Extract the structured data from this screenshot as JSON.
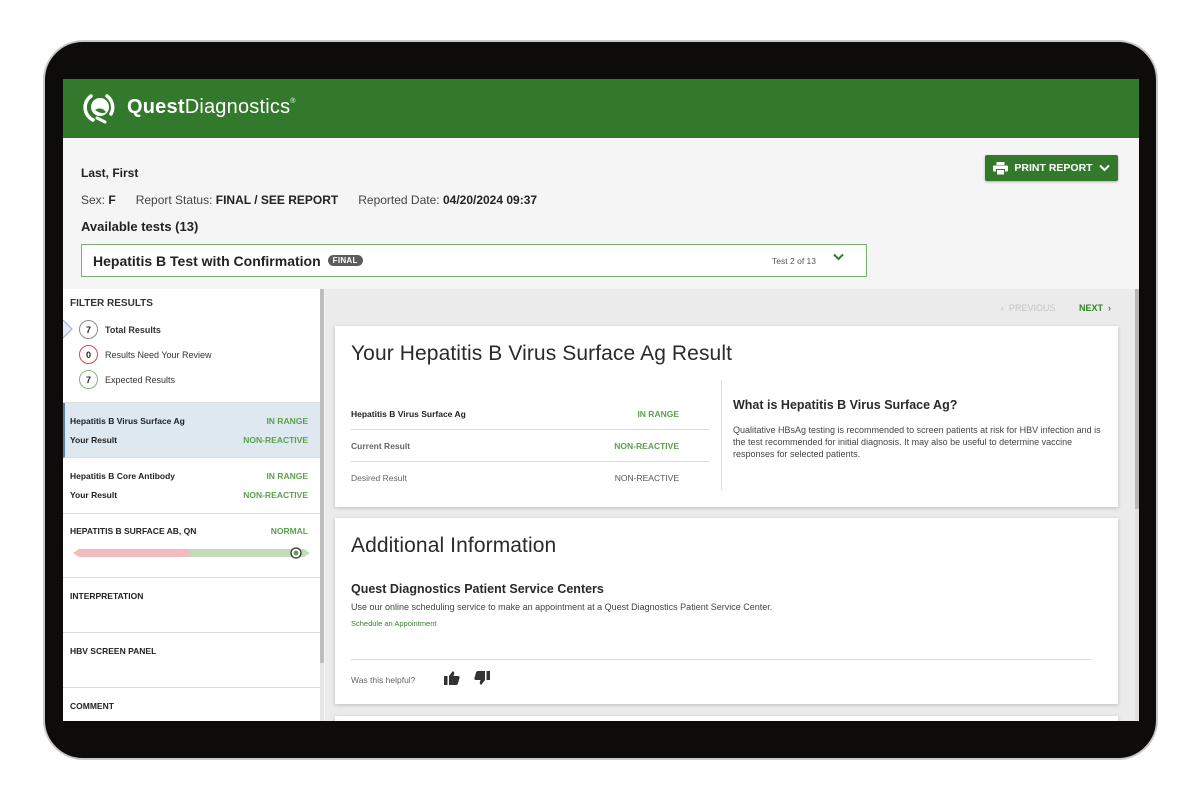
{
  "brand": {
    "name_bold": "Quest",
    "name_regular": "Diagnostics",
    "trademark": "®",
    "header_color": "#33792b",
    "logo_icon": "quest-q-logo-icon"
  },
  "patient": {
    "name": "Last, First",
    "sex_label": "Sex:",
    "sex_value": "F",
    "status_label": "Report Status:",
    "status_value": "FINAL / SEE REPORT",
    "date_label": "Reported Date:",
    "date_value": "04/20/2024 09:37"
  },
  "available_tests": "Available tests (13)",
  "print_button": {
    "label": "PRINT REPORT",
    "icon": "printer-icon"
  },
  "test_selector": {
    "title": "Hepatitis B Test with Confirmation",
    "badge": "FINAL",
    "position": "Test 2 of 13"
  },
  "filters": {
    "heading": "FILTER RESULTS",
    "items": [
      {
        "count": "7",
        "label": "Total Results",
        "color": "#8b8b8b"
      },
      {
        "count": "0",
        "label": "Results Need Your Review",
        "color": "#d24b4b"
      },
      {
        "count": "7",
        "label": "Expected Results",
        "color": "#7dbb72"
      }
    ]
  },
  "sidebar_items": [
    {
      "name": "Hepatitis B Virus Surface Ag",
      "status": "IN RANGE",
      "sub_label": "Your Result",
      "sub_value": "NON-REACTIVE",
      "active": true
    },
    {
      "name": "Hepatitis B Core Antibody",
      "status": "IN RANGE",
      "sub_label": "Your Result",
      "sub_value": "NON-REACTIVE",
      "active": false
    },
    {
      "name": "HEPATITIS B SURFACE AB, QN",
      "status": "NORMAL",
      "range_marker_fraction": 0.94
    },
    {
      "name": "INTERPRETATION"
    },
    {
      "name": "HBV SCREEN PANEL"
    },
    {
      "name": "COMMENT"
    }
  ],
  "pager": {
    "previous": "PREVIOUS",
    "next": "NEXT"
  },
  "result_card": {
    "title": "Your Hepatitis B Virus Surface Ag Result",
    "rows": [
      {
        "label": "Hepatitis B Virus Surface Ag",
        "value": "IN RANGE"
      },
      {
        "label": "Current Result",
        "value": "NON-REACTIVE"
      },
      {
        "label": "Desired Result",
        "value": "NON-REACTIVE"
      }
    ],
    "what_title": "What is Hepatitis B Virus Surface Ag?",
    "what_body": "Qualitative HBsAg testing is recommended to screen patients at risk for HBV infection and is the test recommended for initial diagnosis. It may also be useful to determine vaccine responses for selected patients."
  },
  "additional_card": {
    "title": "Additional Information",
    "psc_title": "Quest Diagnostics Patient Service Centers",
    "psc_body": "Use our online scheduling service to make an appointment at a Quest Diagnostics Patient Service Center.",
    "psc_link": "Schedule an Appointment",
    "helpful_label": "Was this helpful?"
  },
  "colors": {
    "accent_green": "#33792b",
    "status_green": "#5e9f4d",
    "alert_red": "#d24b4b",
    "range_low": "#f2bcbc",
    "range_normal": "#c3dcb8"
  }
}
